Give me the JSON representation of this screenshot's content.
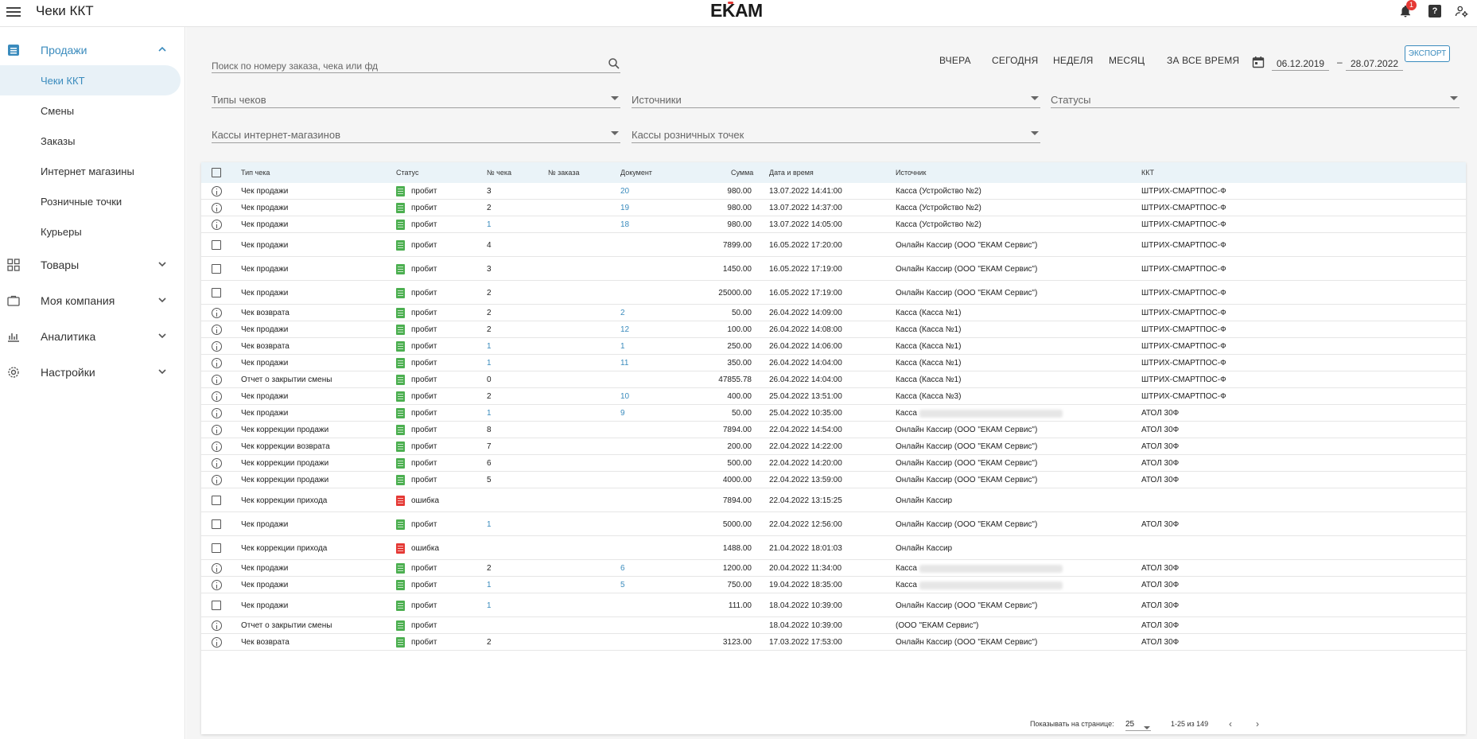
{
  "app": {
    "title": "Чеки ККТ",
    "logo": "EKAM",
    "notifications_count": "1",
    "help_label": "?"
  },
  "sidebar": {
    "groups": [
      {
        "label": "Продажи",
        "icon": "list-icon",
        "active": true
      },
      {
        "label": "Товары",
        "icon": "grid-icon"
      },
      {
        "label": "Моя компания",
        "icon": "briefcase-icon"
      },
      {
        "label": "Аналитика",
        "icon": "analytics-icon"
      },
      {
        "label": "Настройки",
        "icon": "gear-icon"
      }
    ],
    "sales_items": [
      "Чеки ККТ",
      "Смены",
      "Заказы",
      "Интернет магазины",
      "Розничные точки",
      "Курьеры"
    ]
  },
  "filters": {
    "search_placeholder": "Поиск по номеру заказа, чека или фд",
    "check_types": "Типы чеков",
    "sources": "Источники",
    "statuses": "Статусы",
    "online_registers": "Кассы интернет-магазинов",
    "retail_registers": "Кассы розничных точек"
  },
  "period": {
    "yesterday": "ВЧЕРА",
    "today": "СЕГОДНЯ",
    "week": "НЕДЕЛЯ",
    "month": "МЕСЯЦ",
    "all_time": "ЗА ВСЕ ВРЕМЯ",
    "date_from": "06.12.2019",
    "date_to": "28.07.2022",
    "dash": "–",
    "export": "ЭКСПОРТ"
  },
  "table": {
    "headers": {
      "type": "Тип чека",
      "status": "Статус",
      "check_no": "№ чека",
      "order_no": "№ заказа",
      "document": "Документ",
      "sum": "Сумма",
      "datetime": "Дата и время",
      "source": "Источник",
      "kkt": "ККТ"
    },
    "rows": [
      {
        "icon": "info",
        "type": "Чек продажи",
        "status": "пробит",
        "ok": true,
        "check_no": "3",
        "doc": "20",
        "sum": "980.00",
        "dt": "13.07.2022 14:41:00",
        "source": "Касса (Устройство №2)",
        "kkt": "ШТРИХ-СМАРТПОС-Ф"
      },
      {
        "icon": "info",
        "type": "Чек продажи",
        "status": "пробит",
        "ok": true,
        "check_no": "2",
        "doc": "19",
        "sum": "980.00",
        "dt": "13.07.2022 14:37:00",
        "source": "Касса (Устройство №2)",
        "kkt": "ШТРИХ-СМАРТПОС-Ф"
      },
      {
        "icon": "info",
        "type": "Чек продажи",
        "status": "пробит",
        "ok": true,
        "check_no": "1",
        "check_link": true,
        "doc": "18",
        "sum": "980.00",
        "dt": "13.07.2022 14:05:00",
        "source": "Касса (Устройство №2)",
        "kkt": "ШТРИХ-СМАРТПОС-Ф"
      },
      {
        "icon": "check",
        "type": "Чек продажи",
        "status": "пробит",
        "ok": true,
        "check_no": "4",
        "doc": "",
        "sum": "7899.00",
        "dt": "16.05.2022 17:20:00",
        "source": "Онлайн Кассир (ООО \"ЕКАМ Сервис\")",
        "kkt": "ШТРИХ-СМАРТПОС-Ф"
      },
      {
        "icon": "check",
        "type": "Чек продажи",
        "status": "пробит",
        "ok": true,
        "check_no": "3",
        "doc": "",
        "sum": "1450.00",
        "dt": "16.05.2022 17:19:00",
        "source": "Онлайн Кассир (ООО \"ЕКАМ Сервис\")",
        "kkt": "ШТРИХ-СМАРТПОС-Ф"
      },
      {
        "icon": "check",
        "type": "Чек продажи",
        "status": "пробит",
        "ok": true,
        "check_no": "2",
        "doc": "",
        "sum": "25000.00",
        "dt": "16.05.2022 17:19:00",
        "source": "Онлайн Кассир (ООО \"ЕКАМ Сервис\")",
        "kkt": "ШТРИХ-СМАРТПОС-Ф"
      },
      {
        "icon": "info",
        "type": "Чек возврата",
        "status": "пробит",
        "ok": true,
        "check_no": "2",
        "doc": "2",
        "sum": "50.00",
        "dt": "26.04.2022 14:09:00",
        "source": "Касса (Касса №1)",
        "kkt": "ШТРИХ-СМАРТПОС-Ф"
      },
      {
        "icon": "info",
        "type": "Чек продажи",
        "status": "пробит",
        "ok": true,
        "check_no": "2",
        "doc": "12",
        "sum": "100.00",
        "dt": "26.04.2022 14:08:00",
        "source": "Касса (Касса №1)",
        "kkt": "ШТРИХ-СМАРТПОС-Ф"
      },
      {
        "icon": "info",
        "type": "Чек возврата",
        "status": "пробит",
        "ok": true,
        "check_no": "1",
        "check_link": true,
        "doc": "1",
        "sum": "250.00",
        "dt": "26.04.2022 14:06:00",
        "source": "Касса (Касса №1)",
        "kkt": "ШТРИХ-СМАРТПОС-Ф"
      },
      {
        "icon": "info",
        "type": "Чек продажи",
        "status": "пробит",
        "ok": true,
        "check_no": "1",
        "check_link": true,
        "doc": "11",
        "sum": "350.00",
        "dt": "26.04.2022 14:04:00",
        "source": "Касса (Касса №1)",
        "kkt": "ШТРИХ-СМАРТПОС-Ф"
      },
      {
        "icon": "info",
        "type": "Отчет о закрытии смены",
        "status": "пробит",
        "ok": true,
        "check_no": "0",
        "doc": "",
        "sum": "47855.78",
        "dt": "26.04.2022 14:04:00",
        "source": "Касса (Касса №1)",
        "kkt": "ШТРИХ-СМАРТПОС-Ф"
      },
      {
        "icon": "info",
        "type": "Чек продажи",
        "status": "пробит",
        "ok": true,
        "check_no": "2",
        "doc": "10",
        "sum": "400.00",
        "dt": "25.04.2022 13:51:00",
        "source": "Касса (Касса №3)",
        "kkt": "ШТРИХ-СМАРТПОС-Ф"
      },
      {
        "icon": "info",
        "type": "Чек продажи",
        "status": "пробит",
        "ok": true,
        "check_no": "1",
        "check_link": true,
        "doc": "9",
        "sum": "50.00",
        "dt": "25.04.2022 10:35:00",
        "source": "Касса",
        "blur": true,
        "kkt": "АТОЛ 30Ф"
      },
      {
        "icon": "info",
        "type": "Чек коррекции продажи",
        "status": "пробит",
        "ok": true,
        "check_no": "8",
        "doc": "",
        "sum": "7894.00",
        "dt": "22.04.2022 14:54:00",
        "source": "Онлайн Кассир (ООО \"ЕКАМ Сервис\")",
        "kkt": "АТОЛ 30Ф"
      },
      {
        "icon": "info",
        "type": "Чек коррекции возврата",
        "status": "пробит",
        "ok": true,
        "check_no": "7",
        "doc": "",
        "sum": "200.00",
        "dt": "22.04.2022 14:22:00",
        "source": "Онлайн Кассир (ООО \"ЕКАМ Сервис\")",
        "kkt": "АТОЛ 30Ф"
      },
      {
        "icon": "info",
        "type": "Чек коррекции продажи",
        "status": "пробит",
        "ok": true,
        "check_no": "6",
        "doc": "",
        "sum": "500.00",
        "dt": "22.04.2022 14:20:00",
        "source": "Онлайн Кассир (ООО \"ЕКАМ Сервис\")",
        "kkt": "АТОЛ 30Ф"
      },
      {
        "icon": "info",
        "type": "Чек коррекции продажи",
        "status": "пробит",
        "ok": true,
        "check_no": "5",
        "doc": "",
        "sum": "4000.00",
        "dt": "22.04.2022 13:59:00",
        "source": "Онлайн Кассир (ООО \"ЕКАМ Сервис\")",
        "kkt": "АТОЛ 30Ф"
      },
      {
        "icon": "check",
        "type": "Чек коррекции прихода",
        "status": "ошибка",
        "ok": false,
        "check_no": "",
        "doc": "",
        "sum": "7894.00",
        "dt": "22.04.2022 13:15:25",
        "source": "Онлайн Кассир",
        "kkt": ""
      },
      {
        "icon": "check",
        "type": "Чек продажи",
        "status": "пробит",
        "ok": true,
        "check_no": "1",
        "check_link": true,
        "doc": "",
        "sum": "5000.00",
        "dt": "22.04.2022 12:56:00",
        "source": "Онлайн Кассир (ООО \"ЕКАМ Сервис\")",
        "kkt": "АТОЛ 30Ф"
      },
      {
        "icon": "check",
        "type": "Чек коррекции прихода",
        "status": "ошибка",
        "ok": false,
        "check_no": "",
        "doc": "",
        "sum": "1488.00",
        "dt": "21.04.2022 18:01:03",
        "source": "Онлайн Кассир",
        "kkt": ""
      },
      {
        "icon": "info",
        "type": "Чек продажи",
        "status": "пробит",
        "ok": true,
        "check_no": "2",
        "doc": "6",
        "sum": "1200.00",
        "dt": "20.04.2022 11:34:00",
        "source": "Касса",
        "blur": true,
        "kkt": "АТОЛ 30Ф"
      },
      {
        "icon": "info",
        "type": "Чек продажи",
        "status": "пробит",
        "ok": true,
        "check_no": "1",
        "check_link": true,
        "doc": "5",
        "sum": "750.00",
        "dt": "19.04.2022 18:35:00",
        "source": "Касса",
        "blur": true,
        "kkt": "АТОЛ 30Ф"
      },
      {
        "icon": "check",
        "type": "Чек продажи",
        "status": "пробит",
        "ok": true,
        "check_no": "1",
        "check_link": true,
        "doc": "",
        "sum": "111.00",
        "dt": "18.04.2022 10:39:00",
        "source": "Онлайн Кассир (ООО \"ЕКАМ Сервис\")",
        "kkt": "АТОЛ 30Ф"
      },
      {
        "icon": "info",
        "type": "Отчет о закрытии смены",
        "status": "пробит",
        "ok": true,
        "check_no": "",
        "doc": "",
        "sum": "",
        "dt": "18.04.2022 10:39:00",
        "source": "(ООО \"ЕКАМ Сервис\")",
        "kkt": "АТОЛ 30Ф"
      },
      {
        "icon": "info",
        "type": "Чек возврата",
        "status": "пробит",
        "ok": true,
        "check_no": "2",
        "doc": "",
        "sum": "3123.00",
        "dt": "17.03.2022 17:53:00",
        "source": "Онлайн Кассир (ООО \"ЕКАМ Сервис\")",
        "kkt": "АТОЛ 30Ф"
      }
    ]
  },
  "pagination": {
    "per_page_label": "Показывать на странице:",
    "per_page": "25",
    "range": "1-25 из 149",
    "prev": "‹",
    "next": "›"
  },
  "colors": {
    "accent": "#3a8bbd",
    "ok": "#4caf50",
    "error": "#e53935"
  }
}
